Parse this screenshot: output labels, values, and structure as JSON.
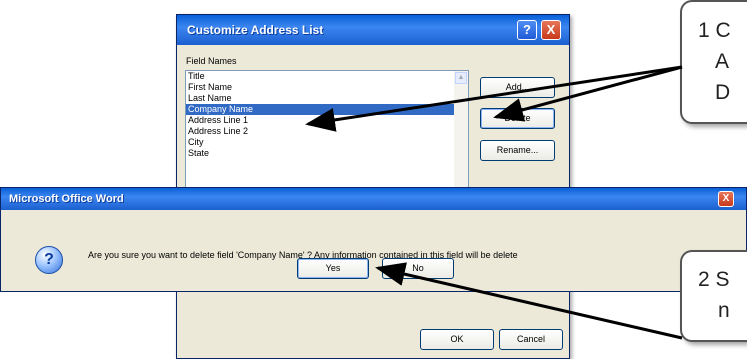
{
  "customize_window": {
    "title": "Customize Address List",
    "help_icon": "?",
    "close_icon": "X",
    "field_names_label": "Field Names",
    "field_names": [
      "Title",
      "First Name",
      "Last Name",
      "Company Name",
      "Address Line 1",
      "Address Line 2",
      "City",
      "State"
    ],
    "selected_index": 3,
    "buttons": {
      "add": "Add...",
      "delete": "Delete",
      "rename": "Rename...",
      "ok": "OK",
      "cancel": "Cancel"
    }
  },
  "word_dialog": {
    "title": "Microsoft Office Word",
    "close_icon": "X",
    "icon": "question-icon",
    "icon_glyph": "?",
    "message": "Are you sure you want to delete field 'Company Name' ? Any information contained in this field will be delete",
    "buttons": {
      "yes": "Yes",
      "no": "No"
    }
  },
  "callouts": [
    {
      "lines": [
        "1 C",
        "A",
        "D"
      ]
    },
    {
      "lines": [
        "2 S",
        "n"
      ]
    }
  ],
  "colors": {
    "titlebar": "#0a5fd8",
    "selection": "#316ac5",
    "dialog_bg": "#ece9d8",
    "arrow": "#000000"
  }
}
